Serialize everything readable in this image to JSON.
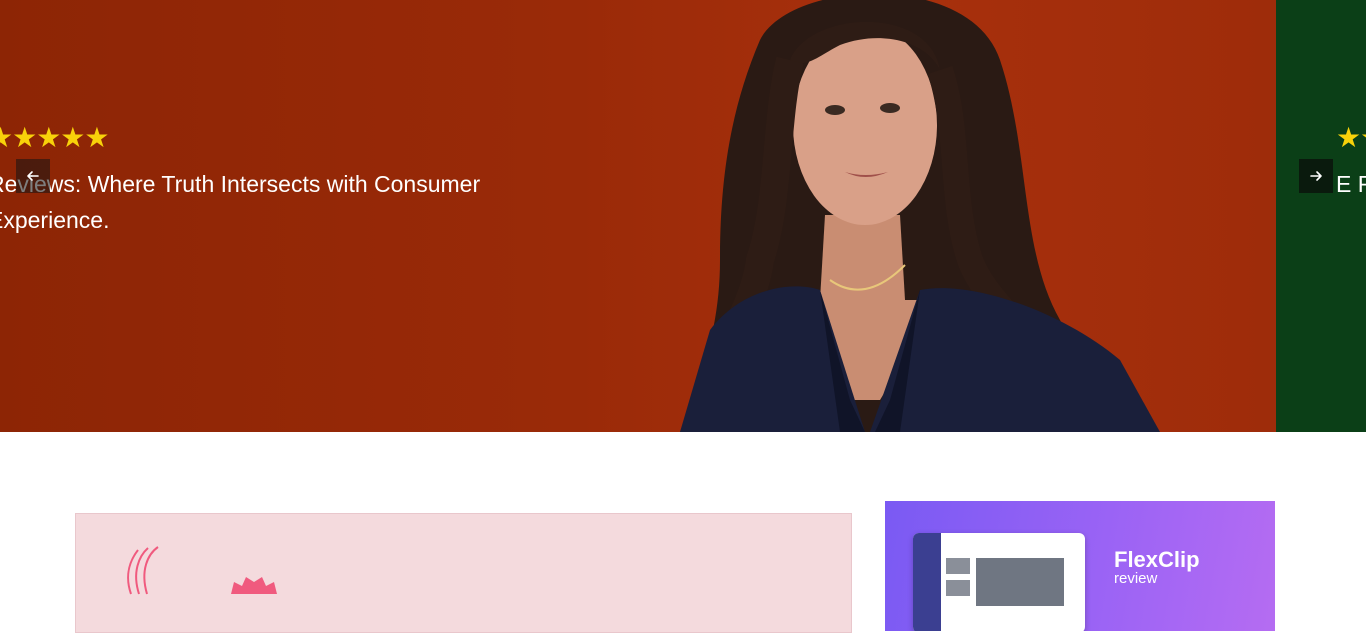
{
  "slider": {
    "slides": [
      {
        "rating": "★★★★★",
        "text": "Reviews: Where Truth Intersects with Consumer Experience.",
        "bg": "#9a2a08"
      },
      {
        "rating": "★★★★★",
        "text": "E F",
        "bg": "#0b3f17"
      }
    ],
    "star_color": "#f8d20a",
    "prev_icon": "arrow-left-icon",
    "next_icon": "arrow-right-icon"
  },
  "cards": {
    "pink": {
      "bg": "#f4dadd"
    },
    "promo": {
      "title": "FlexClip",
      "subtitle": "review",
      "bg": "#8b5ef4"
    }
  }
}
